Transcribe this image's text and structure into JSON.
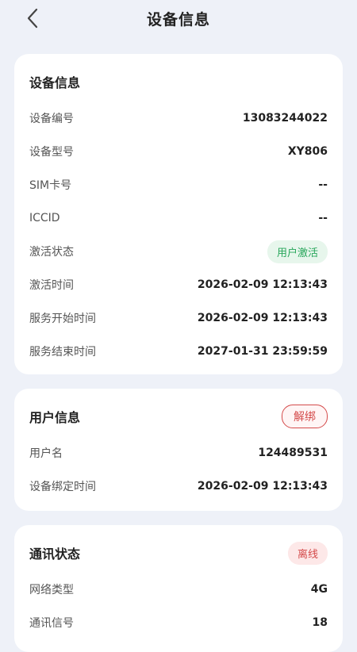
{
  "header": {
    "title": "设备信息",
    "back_icon": "chevron-left-icon"
  },
  "device_card": {
    "title": "设备信息",
    "rows": [
      {
        "label": "设备编号",
        "value": "13083244022"
      },
      {
        "label": "设备型号",
        "value": "XY806"
      },
      {
        "label": "SIM卡号",
        "value": "--"
      },
      {
        "label": "ICCID",
        "value": "--"
      },
      {
        "label": "激活状态",
        "value": "用户激活"
      },
      {
        "label": "激活时间",
        "value": "2026-02-09 12:13:43"
      },
      {
        "label": "服务开始时间",
        "value": "2026-02-09 12:13:43"
      },
      {
        "label": "服务结束时间",
        "value": "2027-01-31 23:59:59"
      }
    ]
  },
  "user_card": {
    "title": "用户信息",
    "unbind_label": "解绑",
    "rows": [
      {
        "label": "用户名",
        "value": "124489531"
      },
      {
        "label": "设备绑定时间",
        "value": "2026-02-09 12:13:43"
      }
    ]
  },
  "comm_card": {
    "title": "通讯状态",
    "status": "离线",
    "rows": [
      {
        "label": "网络类型",
        "value": "4G"
      },
      {
        "label": "通讯信号",
        "value": "18"
      }
    ]
  },
  "colors": {
    "background": "#eef1f8",
    "green": "#27a65a",
    "red": "#d44a4a"
  }
}
